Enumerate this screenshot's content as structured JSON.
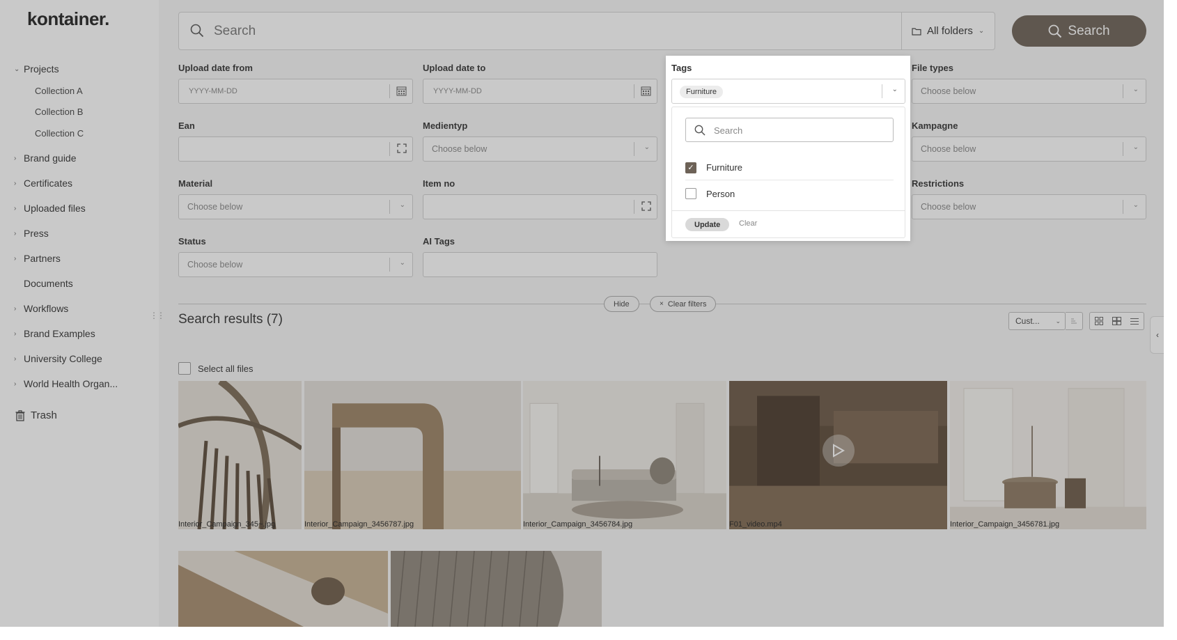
{
  "app": {
    "logo": "kontainer.",
    "trash_label": "Trash"
  },
  "sidebar": {
    "projects": "Projects",
    "collections": [
      "Collection A",
      "Collection B",
      "Collection C"
    ],
    "items": [
      "Brand guide",
      "Certificates",
      "Uploaded files",
      "Press",
      "Partners",
      "Documents",
      "Workflows",
      "Brand Examples",
      "University College",
      "World Health Organ..."
    ]
  },
  "search": {
    "placeholder": "Search",
    "folder_label": "All folders",
    "button_label": "Search"
  },
  "filters": {
    "upload_from": {
      "label": "Upload date from",
      "placeholder": "YYYY-MM-DD"
    },
    "upload_to": {
      "label": "Upload date to",
      "placeholder": "YYYY-MM-DD"
    },
    "file_types": {
      "label": "File types",
      "placeholder": "Choose below"
    },
    "ean": {
      "label": "Ean"
    },
    "medientyp": {
      "label": "Medientyp",
      "placeholder": "Choose below"
    },
    "kampagne": {
      "label": "Kampagne",
      "placeholder": "Choose below"
    },
    "material": {
      "label": "Material",
      "placeholder": "Choose below"
    },
    "item_no": {
      "label": "Item no"
    },
    "restrictions": {
      "label": "Restrictions",
      "placeholder": "Choose below"
    },
    "status": {
      "label": "Status",
      "placeholder": "Choose below"
    },
    "ai_tags": {
      "label": "AI Tags"
    }
  },
  "tags": {
    "label": "Tags",
    "selected_chip": "Furniture",
    "search_placeholder": "Search",
    "options": [
      {
        "label": "Furniture",
        "checked": true
      },
      {
        "label": "Person",
        "checked": false
      }
    ],
    "update_label": "Update",
    "clear_label": "Clear"
  },
  "toolbar": {
    "hide_label": "Hide",
    "clear_filters_label": "Clear filters",
    "results_title": "Search results (7)",
    "sort_label": "Cust...",
    "select_all_label": "Select all files"
  },
  "results": [
    {
      "name": "Interior_Campaign_345~.jpg"
    },
    {
      "name": "Interior_Campaign_3456787.jpg"
    },
    {
      "name": "Interior_Campaign_3456784.jpg"
    },
    {
      "name": "F01_video.mp4"
    },
    {
      "name": "Interior_Campaign_3456781.jpg"
    }
  ]
}
